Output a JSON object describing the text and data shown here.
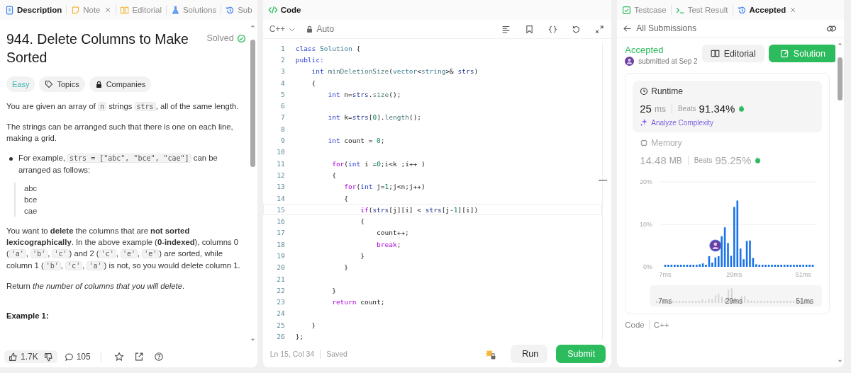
{
  "left_panel": {
    "tabs": [
      {
        "label": "Description",
        "selected": true,
        "closable": false
      },
      {
        "label": "Note",
        "selected": false,
        "closable": true
      },
      {
        "label": "Editorial",
        "selected": false,
        "closable": false
      },
      {
        "label": "Solutions",
        "selected": false,
        "closable": false
      },
      {
        "label": "Sub",
        "selected": false,
        "closable": false
      }
    ],
    "title": "944. Delete Columns to Make Sorted",
    "status": "Solved",
    "tags": [
      {
        "label": "Easy",
        "kind": "difficulty"
      },
      {
        "label": "Topics",
        "kind": "topics"
      },
      {
        "label": "Companies",
        "kind": "companies"
      }
    ],
    "description": [
      {
        "kind": "para",
        "segments": [
          {
            "kind": "text",
            "text": "You are given an array of "
          },
          {
            "kind": "code",
            "text": "n"
          },
          {
            "kind": "text",
            "text": " strings "
          },
          {
            "kind": "code",
            "text": "strs"
          },
          {
            "kind": "text",
            "text": ", all of the same length."
          }
        ]
      },
      {
        "kind": "para",
        "segments": [
          {
            "kind": "text",
            "text": "The strings can be arranged such that there is one on each line, making a grid."
          }
        ]
      },
      {
        "kind": "bullet",
        "segments": [
          {
            "kind": "text",
            "text": "For example, "
          },
          {
            "kind": "code",
            "text": "strs = [\"abc\", \"bce\", \"cae\"]"
          },
          {
            "kind": "text",
            "text": " can be arranged as follows:"
          }
        ]
      },
      {
        "kind": "block",
        "lines": [
          "abc",
          "bce",
          "cae"
        ]
      },
      {
        "kind": "para",
        "segments": [
          {
            "kind": "text",
            "text": "You want to **delete** the columns that are **not sorted lexicographically**. In the above example (**0-indexed**), columns 0 ("
          },
          {
            "kind": "code",
            "text": "'a'"
          },
          {
            "kind": "text",
            "text": ", "
          },
          {
            "kind": "code",
            "text": "'b'"
          },
          {
            "kind": "text",
            "text": ", "
          },
          {
            "kind": "code",
            "text": "'c'"
          },
          {
            "kind": "text",
            "text": ") and 2 ("
          },
          {
            "kind": "code",
            "text": "'c'"
          },
          {
            "kind": "text",
            "text": ", "
          },
          {
            "kind": "code",
            "text": "'e'"
          },
          {
            "kind": "text",
            "text": ", "
          },
          {
            "kind": "code",
            "text": "'e'"
          },
          {
            "kind": "text",
            "text": ") are sorted, while column 1 ("
          },
          {
            "kind": "code",
            "text": "'b'"
          },
          {
            "kind": "text",
            "text": ", "
          },
          {
            "kind": "code",
            "text": "'c'"
          },
          {
            "kind": "text",
            "text": ", "
          },
          {
            "kind": "code",
            "text": "'a'"
          },
          {
            "kind": "text",
            "text": ") is not, so you would delete column 1."
          }
        ]
      },
      {
        "kind": "para",
        "segments": [
          {
            "kind": "text",
            "text": "Return *the number of columns that you will delete*."
          }
        ]
      },
      {
        "kind": "heading",
        "text": "Example 1:"
      }
    ],
    "footer": {
      "likes": "1.7K",
      "comments": "105"
    }
  },
  "code_panel": {
    "title": "Code",
    "language": "C++",
    "mode": "Auto",
    "lines": [
      {
        "number": "1",
        "active": false,
        "tokens": [
          {
            "kind": "keyword",
            "text": "class "
          },
          {
            "kind": "type",
            "text": "Solution"
          },
          {
            "kind": "plain",
            "text": " {"
          }
        ]
      },
      {
        "number": "2",
        "active": false,
        "tokens": [
          {
            "kind": "keyword",
            "text": "public:"
          }
        ]
      },
      {
        "number": "3",
        "active": false,
        "tokens": [
          {
            "kind": "keyword",
            "text": "    int "
          },
          {
            "kind": "function",
            "text": "minDeletionSize"
          },
          {
            "kind": "plain",
            "text": "("
          },
          {
            "kind": "type",
            "text": "vector"
          },
          {
            "kind": "plain",
            "text": "<"
          },
          {
            "kind": "type",
            "text": "string"
          },
          {
            "kind": "plain",
            "text": ">& "
          },
          {
            "kind": "variable",
            "text": "strs"
          },
          {
            "kind": "plain",
            "text": ")"
          }
        ]
      },
      {
        "number": "4",
        "active": false,
        "tokens": [
          {
            "kind": "plain",
            "text": "    {"
          }
        ]
      },
      {
        "number": "5",
        "active": false,
        "tokens": [
          {
            "kind": "keyword",
            "text": "        int"
          },
          {
            "kind": "plain",
            "text": " n="
          },
          {
            "kind": "variable",
            "text": "strs"
          },
          {
            "kind": "plain",
            "text": "."
          },
          {
            "kind": "function",
            "text": "size"
          },
          {
            "kind": "plain",
            "text": "();"
          }
        ]
      },
      {
        "number": "6",
        "active": false
      },
      {
        "number": "7",
        "active": false,
        "tokens": [
          {
            "kind": "keyword",
            "text": "        int"
          },
          {
            "kind": "plain",
            "text": " k="
          },
          {
            "kind": "variable",
            "text": "strs"
          },
          {
            "kind": "plain",
            "text": "["
          },
          {
            "kind": "number",
            "text": "0"
          },
          {
            "kind": "plain",
            "text": "]."
          },
          {
            "kind": "function",
            "text": "length"
          },
          {
            "kind": "plain",
            "text": "();"
          }
        ]
      },
      {
        "number": "8",
        "active": false
      },
      {
        "number": "9",
        "active": false,
        "tokens": [
          {
            "kind": "keyword",
            "text": "        int"
          },
          {
            "kind": "plain",
            "text": " count = "
          },
          {
            "kind": "number",
            "text": "0"
          },
          {
            "kind": "plain",
            "text": ";"
          }
        ]
      },
      {
        "number": "10",
        "active": false
      },
      {
        "number": "11",
        "active": false,
        "tokens": [
          {
            "kind": "control",
            "text": "         for"
          },
          {
            "kind": "plain",
            "text": "("
          },
          {
            "kind": "keyword",
            "text": "int"
          },
          {
            "kind": "plain",
            "text": " i ="
          },
          {
            "kind": "number",
            "text": "0"
          },
          {
            "kind": "plain",
            "text": ";i<k ;i++ )"
          }
        ]
      },
      {
        "number": "12",
        "active": false,
        "tokens": [
          {
            "kind": "plain",
            "text": "         {"
          }
        ]
      },
      {
        "number": "13",
        "active": false,
        "tokens": [
          {
            "kind": "control",
            "text": "            for"
          },
          {
            "kind": "plain",
            "text": "("
          },
          {
            "kind": "keyword",
            "text": "int"
          },
          {
            "kind": "plain",
            "text": " j="
          },
          {
            "kind": "number",
            "text": "1"
          },
          {
            "kind": "plain",
            "text": ";j<n;j++)"
          }
        ]
      },
      {
        "number": "14",
        "active": false,
        "tokens": [
          {
            "kind": "plain",
            "text": "            {"
          }
        ]
      },
      {
        "number": "15",
        "active": true,
        "tokens": [
          {
            "kind": "control",
            "text": "                if"
          },
          {
            "kind": "plain",
            "text": "("
          },
          {
            "kind": "variable",
            "text": "strs"
          },
          {
            "kind": "plain",
            "text": "[j][i] < "
          },
          {
            "kind": "variable",
            "text": "strs"
          },
          {
            "kind": "plain",
            "text": "[j-"
          },
          {
            "kind": "number",
            "text": "1"
          },
          {
            "kind": "plain",
            "text": "][i])"
          }
        ]
      },
      {
        "number": "16",
        "active": false,
        "tokens": [
          {
            "kind": "plain",
            "text": "                {"
          }
        ]
      },
      {
        "number": "17",
        "active": false,
        "tokens": [
          {
            "kind": "plain",
            "text": "                    count++;"
          }
        ]
      },
      {
        "number": "18",
        "active": false,
        "tokens": [
          {
            "kind": "control",
            "text": "                    break"
          },
          {
            "kind": "plain",
            "text": ";"
          }
        ]
      },
      {
        "number": "19",
        "active": false,
        "tokens": [
          {
            "kind": "plain",
            "text": "                }"
          }
        ]
      },
      {
        "number": "20",
        "active": false,
        "tokens": [
          {
            "kind": "plain",
            "text": "            }"
          }
        ]
      },
      {
        "number": "21",
        "active": false
      },
      {
        "number": "22",
        "active": false,
        "tokens": [
          {
            "kind": "plain",
            "text": "         }"
          }
        ]
      },
      {
        "number": "23",
        "active": false,
        "tokens": [
          {
            "kind": "control",
            "text": "         return"
          },
          {
            "kind": "plain",
            "text": " count;"
          }
        ]
      },
      {
        "number": "24",
        "active": false
      },
      {
        "number": "25",
        "active": false,
        "tokens": [
          {
            "kind": "plain",
            "text": "    }"
          }
        ]
      },
      {
        "number": "26",
        "active": false,
        "tokens": [
          {
            "kind": "plain",
            "text": "};"
          }
        ]
      }
    ],
    "cursor": "Ln 15, Col 34",
    "save_state": "Saved",
    "buttons": [
      {
        "label": "Run",
        "kind": "secondary"
      },
      {
        "label": "Submit",
        "kind": "primary"
      }
    ]
  },
  "result_panel": {
    "tabs": [
      {
        "label": "Testcase",
        "selected": false,
        "closable": false
      },
      {
        "label": "Test Result",
        "selected": false,
        "closable": false
      },
      {
        "label": "Accepted",
        "selected": true,
        "closable": true
      }
    ],
    "back_label": "All Submissions",
    "verdict": "Accepted",
    "submitted": "submitted at Sep 2",
    "buttons": [
      {
        "label": "Editorial",
        "kind": "secondary"
      },
      {
        "label": "Solution",
        "kind": "primary"
      }
    ],
    "metrics": [
      {
        "label": "Runtime",
        "kind": "runtime",
        "selected": true,
        "value": "25",
        "unit": "ms",
        "beats_label": "Beats",
        "beats": "91.34%",
        "link": "Analyze Complexity"
      },
      {
        "label": "Memory",
        "kind": "memory",
        "selected": false,
        "value": "14.48",
        "unit": "MB",
        "beats_label": "Beats",
        "beats": "95.25%"
      }
    ],
    "chart_data": {
      "type": "bar",
      "x": [
        7,
        8,
        9,
        10,
        11,
        12,
        13,
        14,
        15,
        16,
        17,
        18,
        19,
        20,
        21,
        22,
        23,
        24,
        25,
        26,
        27,
        28,
        29,
        30,
        31,
        32,
        33,
        34,
        35,
        36,
        37,
        38,
        39,
        40,
        41,
        42,
        43,
        44,
        45,
        46,
        47,
        48,
        49,
        50,
        51,
        52,
        53,
        54
      ],
      "xlim": [
        7,
        54
      ],
      "series": [
        {
          "color": "#1a73e8",
          "values": [
            0.5,
            0.5,
            0.5,
            0.5,
            0.5,
            0.5,
            0.5,
            0.5,
            0.5,
            0.5,
            0.5,
            0.6,
            0.8,
            0.5,
            2.5,
            1.0,
            2.2,
            2.5,
            7.2,
            9.3,
            5.6,
            2.6,
            14.1,
            15.6,
            4.3,
            1.8,
            6.1,
            6.2,
            2.1,
            0.6,
            0.5,
            0.5,
            0.5,
            0.5,
            0.5,
            0.5,
            0.5,
            0.5,
            0.5,
            0.5,
            0.5,
            0.5,
            0.5,
            0.5,
            0.5,
            0.5,
            0.5,
            0.5
          ]
        }
      ],
      "ylim": [
        0,
        20
      ],
      "yticks": [
        {
          "value": 0,
          "label": "0%"
        },
        {
          "value": 10,
          "label": "10%"
        },
        {
          "value": 20,
          "label": "20%"
        }
      ],
      "xticks": [
        {
          "value": 7,
          "label": "7ms"
        },
        {
          "value": 29,
          "label": "29ms"
        },
        {
          "value": 51,
          "label": "51ms"
        }
      ]
    },
    "brush_labels": [
      "7ms",
      "29ms",
      "51ms"
    ],
    "code_label": "Code",
    "code_language": "C++"
  }
}
